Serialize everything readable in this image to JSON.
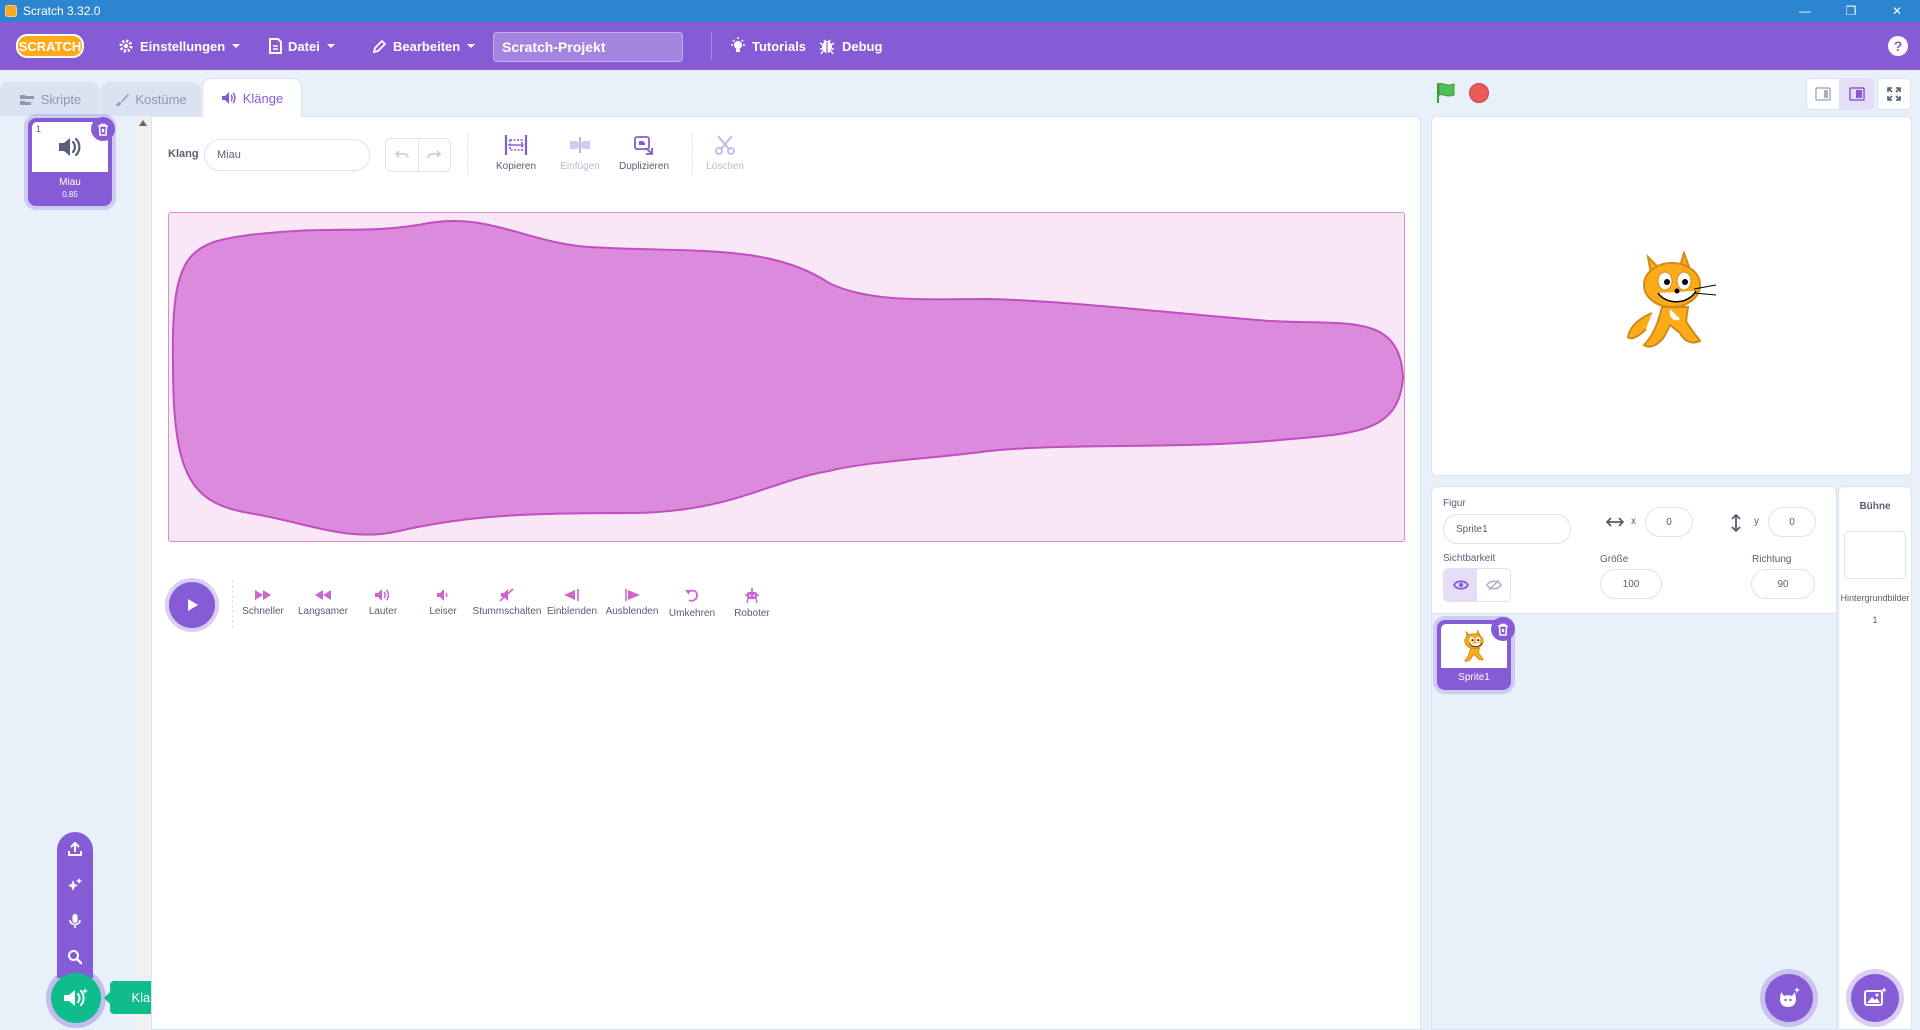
{
  "window": {
    "title": "Scratch 3.32.0",
    "minimize_glyph": "—",
    "maximize_glyph": "❐",
    "close_glyph": "✕"
  },
  "menubar": {
    "logo_text": "SCRATCH",
    "settings_label": "Einstellungen",
    "file_label": "Datei",
    "edit_label": "Bearbeiten",
    "project_title": "Scratch-Projekt",
    "tutorials_label": "Tutorials",
    "debug_label": "Debug",
    "help_glyph": "?"
  },
  "tabs": {
    "code": "Skripte",
    "costumes": "Kostüme",
    "sounds": "Klänge"
  },
  "sound_list": [
    {
      "index": "1",
      "name": "Miau",
      "duration": "0.85"
    }
  ],
  "add_sound": {
    "tooltip": "Klang wählen"
  },
  "editor": {
    "sound_label": "Klang",
    "sound_name": "Miau",
    "tools": {
      "copy": "Kopieren",
      "paste": "Einfügen",
      "copy_to_new": "Duplizieren",
      "delete": "Löschen"
    },
    "effects": {
      "faster": "Schneller",
      "slower": "Langsamer",
      "louder": "Lauter",
      "softer": "Leiser",
      "mute": "Stummschalten",
      "fade_in": "Einblenden",
      "fade_out": "Ausblenden",
      "reverse": "Umkehren",
      "robot": "Roboter"
    }
  },
  "colors": {
    "primary": "#855cd6",
    "sound_accent": "#cf63cf",
    "extension_green": "#0fbd8c",
    "stop_red": "#ec5959",
    "flag_green": "#4cbf56"
  },
  "sprite_info": {
    "sprite_label": "Figur",
    "sprite_name": "Sprite1",
    "x_label": "x",
    "x_value": "0",
    "y_label": "y",
    "y_value": "0",
    "show_label": "Sichtbarkeit",
    "size_label": "Größe",
    "size_value": "100",
    "direction_label": "Richtung",
    "direction_value": "90"
  },
  "sprites": [
    {
      "name": "Sprite1"
    }
  ],
  "stage_pane": {
    "title": "Bühne",
    "backdrops_label": "Hintergrundbilder",
    "backdrops_count": "1"
  }
}
